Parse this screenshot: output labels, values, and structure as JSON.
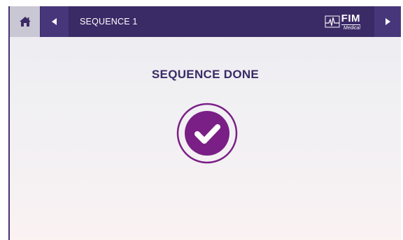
{
  "header": {
    "home_icon": "home-icon",
    "back_icon": "triangle-left-icon",
    "sequence_title": "SEQUENCE 1",
    "logo": {
      "main": "FIM",
      "sub": "Medical"
    },
    "forward_icon": "triangle-right-icon"
  },
  "main": {
    "status_title": "SEQUENCE DONE",
    "status_icon": "check-circle-icon"
  },
  "colors": {
    "header_bg": "#3a2a66",
    "home_bg": "#c9c7d3",
    "accent": "#7a1f86",
    "title_text": "#3a2a66"
  }
}
